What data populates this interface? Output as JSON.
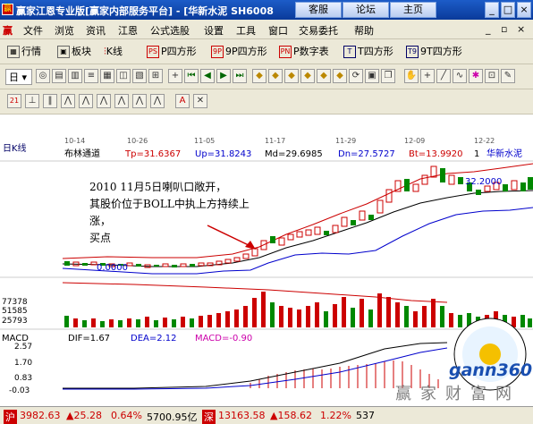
{
  "window": {
    "title": "赢家江恩专业版[赢家内部服务平台] - [华新水泥  SH6008",
    "buttons": [
      "客服",
      "论坛",
      "主页"
    ]
  },
  "menu": [
    "文件",
    "浏览",
    "资讯",
    "江恩",
    "公式选股",
    "设置",
    "工具",
    "窗口",
    "交易委托",
    "帮助"
  ],
  "toolbar1": [
    "行情",
    "板块",
    "K线",
    "P四方形",
    "9P四方形",
    "P数字表",
    "T四方形",
    "9T四方形"
  ],
  "toolbar1_icons": [
    "PS",
    "9P",
    "PN",
    "T",
    "T9"
  ],
  "toolbar2": {
    "period": "日"
  },
  "toolbar3": {
    "num": "21"
  },
  "chart": {
    "period_label": "日K线",
    "dates": [
      "10-14",
      "10-26",
      "11-05",
      "11-17",
      "11-29",
      "12-09",
      "12-22"
    ],
    "indicator": "布林通道",
    "tp": "Tp=31.6367",
    "up": "Up=31.8243",
    "md": "Md=29.6985",
    "dn": "Dn=27.5727",
    "bt": "Bt=13.9920",
    "stock_no": "1",
    "stock_name": "华新水泥",
    "price_high": "32.2000",
    "price_low": "0.0000",
    "annotation_lines": [
      "2010 11月5日喇叭口敞开，",
      "其股价位于BOLL中执上方持续上",
      "涨，",
      "买点"
    ],
    "vol_ticks": [
      "77378",
      "51585",
      "25793"
    ]
  },
  "macd": {
    "title": "MACD",
    "dif": "DIF=1.67",
    "dea": "DEA=2.12",
    "macd": "MACD=-0.90",
    "ticks": [
      "2.57",
      "1.70",
      "0.83",
      "-0.03"
    ]
  },
  "watermark": {
    "brand": "gann360",
    "site": "赢家财富网"
  },
  "status": {
    "sh_label": "沪",
    "sh_index": "3982.63",
    "sh_change": "▲25.28",
    "sh_pct": "0.64%",
    "sh_amount": "5700.95亿",
    "sz_label": "深",
    "sz_index": "13163.58",
    "sz_change": "▲158.62",
    "sz_pct": "1.22%",
    "sz_amount": "537"
  },
  "colors": {
    "up": "#ff0000",
    "down": "#008000",
    "titlebar": "#0a3a9a"
  }
}
